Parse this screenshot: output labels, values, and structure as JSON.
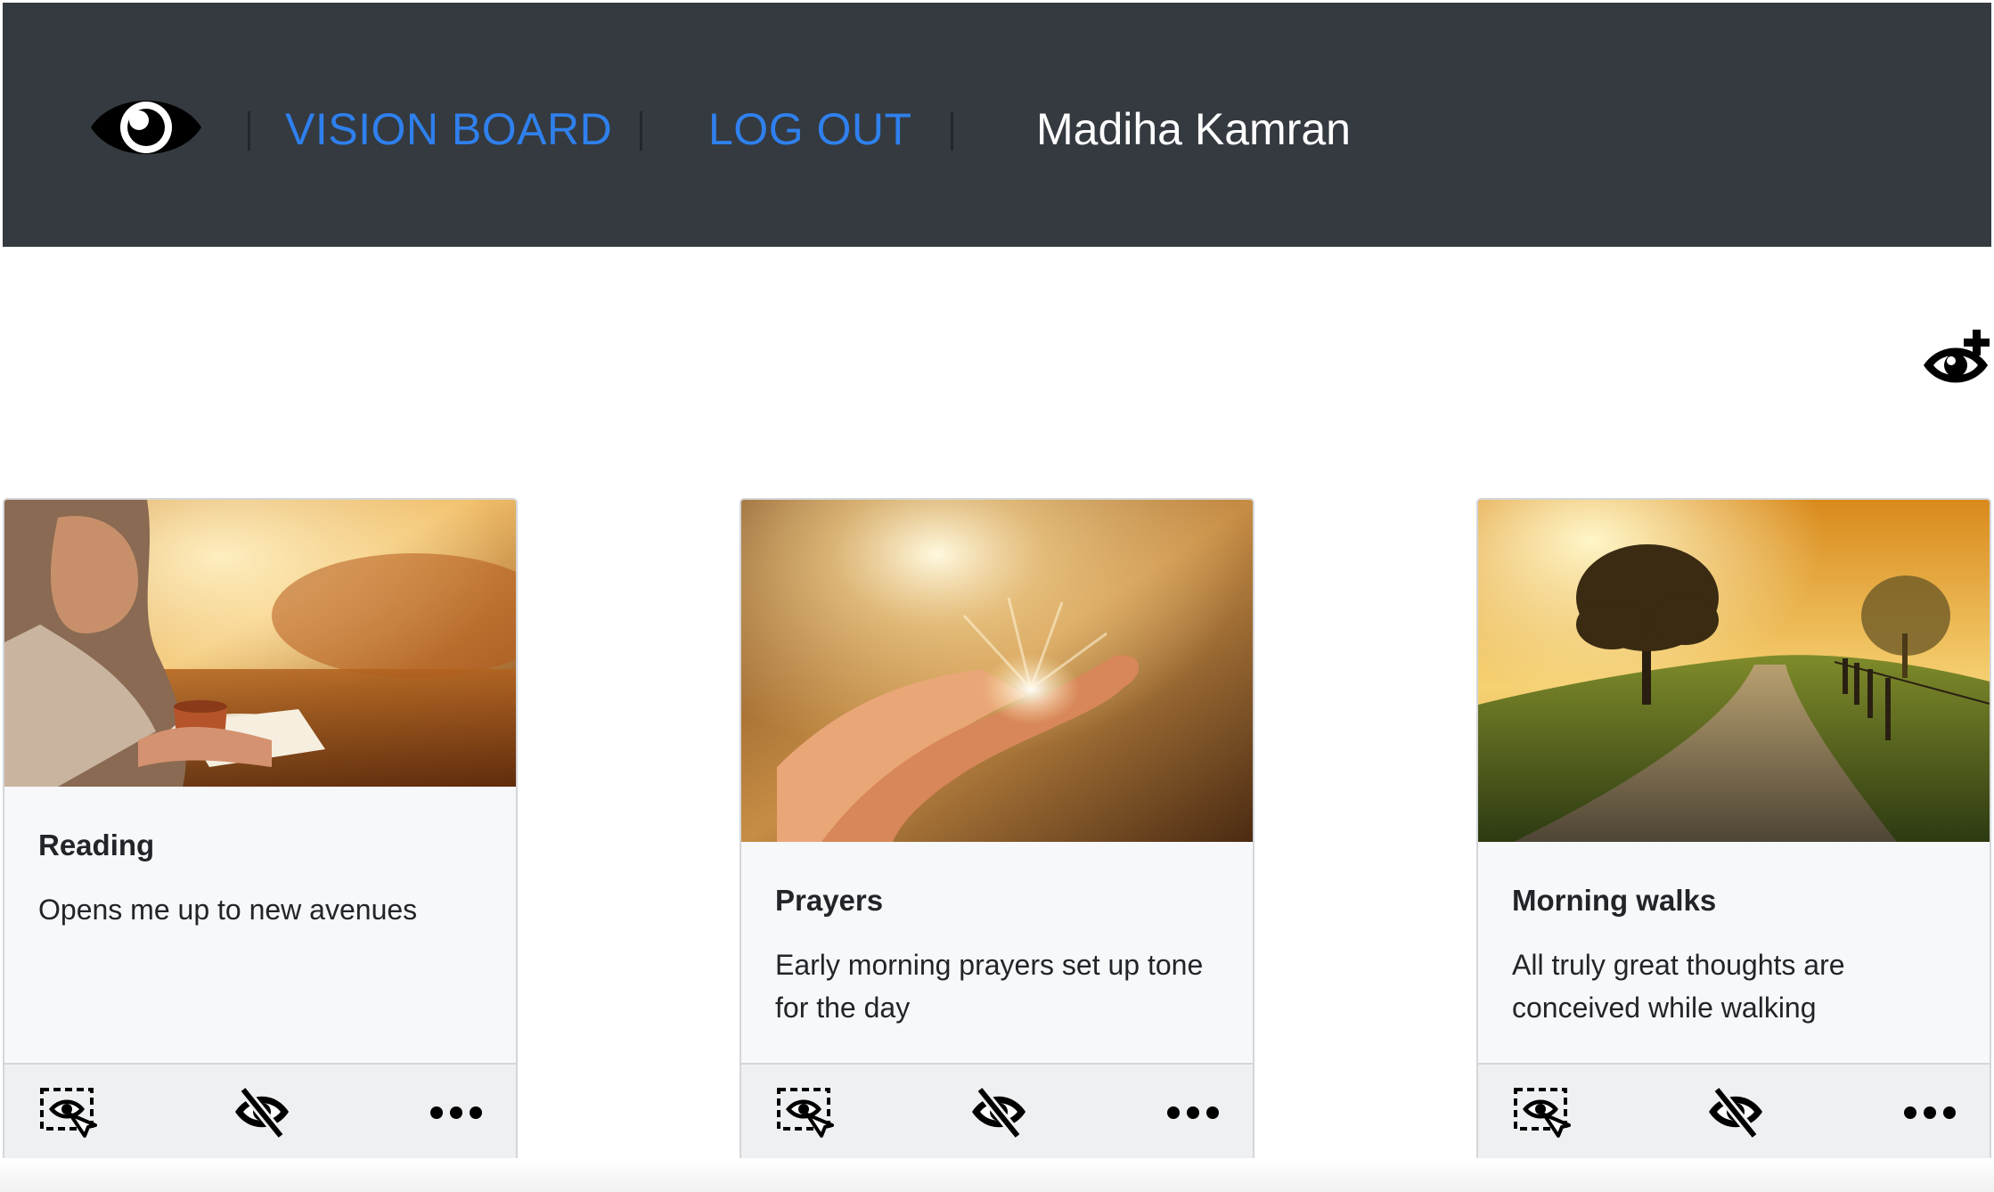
{
  "nav": {
    "logo_icon": "eye-icon",
    "vision_board_label": "VISION BOARD",
    "logout_label": "LOG OUT",
    "user_name": "Madiha Kamran",
    "link_color": "#2f80ed",
    "bar_color": "#343a40"
  },
  "toolbar": {
    "add_vision_icon": "eye-plus-icon"
  },
  "cards": [
    {
      "title": "Reading",
      "text": "Opens me up to new avenues",
      "image": "woman reading a book with a cup in a golden autumn field"
    },
    {
      "title": "Prayers",
      "text": "Early morning prayers set up tone for the day",
      "image": "open hands raised toward bright sunlight"
    },
    {
      "title": "Morning walks",
      "text": "All truly great thoughts are conceived while walking",
      "image": "country road with a tree at sunrise"
    }
  ],
  "card_actions": {
    "select_icon": "select-area-eye-icon",
    "hide_icon": "eye-slash-icon",
    "more_icon": "ellipsis-icon"
  }
}
